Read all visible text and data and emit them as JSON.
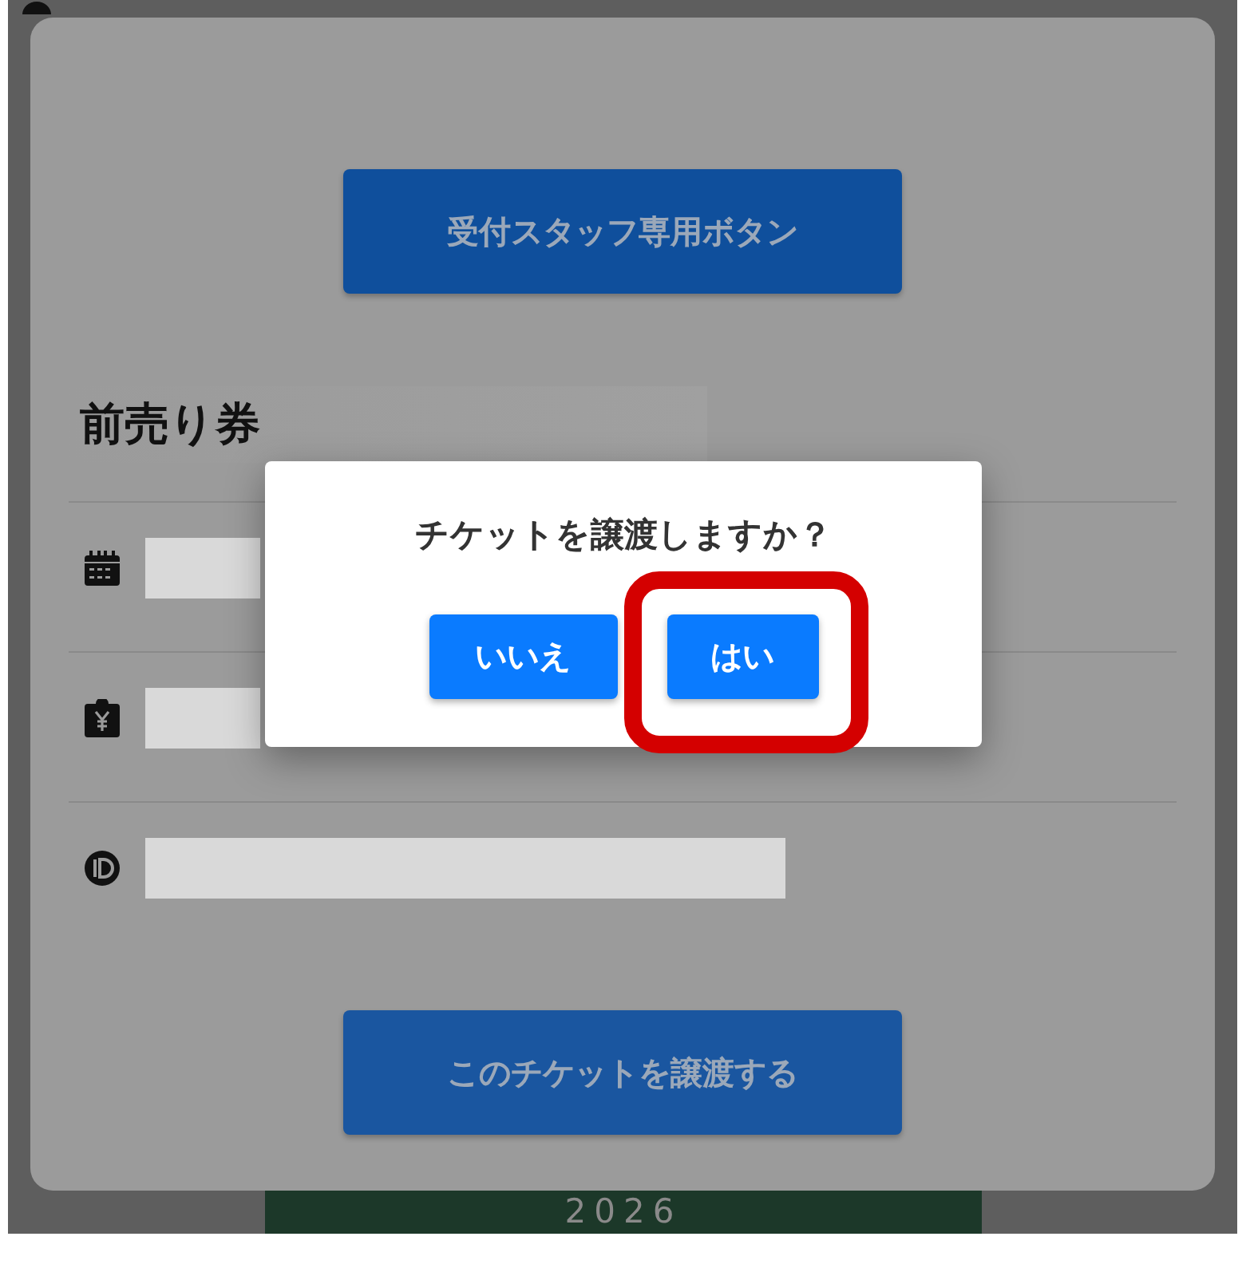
{
  "ticket_card": {
    "staff_button": "受付スタッフ専用ボタン",
    "section_title": "前売り券",
    "rows": [
      {
        "kind": "date"
      },
      {
        "kind": "price"
      },
      {
        "kind": "id"
      }
    ],
    "transfer_button": "このチケットを譲渡する"
  },
  "poster": {
    "year": "2026"
  },
  "dialog": {
    "message": "チケットを譲渡しますか？",
    "buttons": [
      {
        "label": "いいえ",
        "highlighted": false
      },
      {
        "label": "はい",
        "highlighted": true
      }
    ]
  }
}
